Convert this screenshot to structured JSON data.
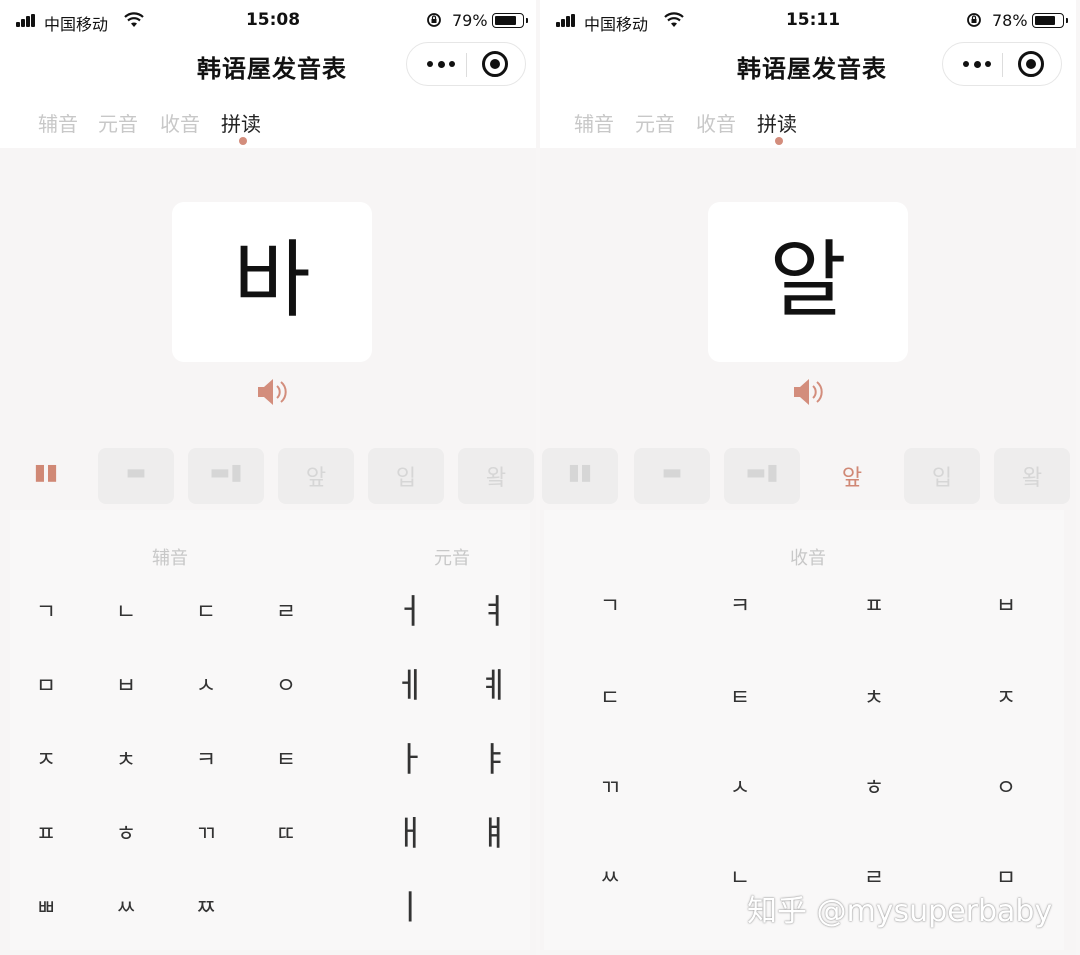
{
  "left": {
    "status": {
      "carrier": "中国移动",
      "time": "15:08",
      "battery": "79%",
      "battery_level": 0.79
    },
    "header": {
      "title": "韩语屋发音表"
    },
    "tabs": [
      {
        "label": "辅音"
      },
      {
        "label": "元音"
      },
      {
        "label": "收音"
      },
      {
        "label": "拼读"
      }
    ],
    "active_tab": 3,
    "syllable": "바",
    "modes": [
      {
        "glyph": "▮▮"
      },
      {
        "glyph": "▬"
      },
      {
        "glyph": "▬▮"
      },
      {
        "glyph": "앞"
      },
      {
        "glyph": "입"
      },
      {
        "glyph": "왘"
      }
    ],
    "active_mode": 0,
    "consonant_header": "辅音",
    "vowel_header": "元音",
    "consonants": [
      "ㄱ",
      "ㄴ",
      "ㄷ",
      "ㄹ",
      "ㅁ",
      "ㅂ",
      "ㅅ",
      "ㅇ",
      "ㅈ",
      "ㅊ",
      "ㅋ",
      "ㅌ",
      "ㅍ",
      "ㅎ",
      "ㄲ",
      "ㄸ",
      "ㅃ",
      "ㅆ",
      "ㅉ"
    ],
    "vowels": [
      "ㅓ",
      "ㅕ",
      "ㅔ",
      "ㅖ",
      "ㅏ",
      "ㅑ",
      "ㅐ",
      "ㅒ",
      "ㅣ"
    ]
  },
  "right": {
    "status": {
      "carrier": "中国移动",
      "time": "15:11",
      "battery": "78%",
      "battery_level": 0.78
    },
    "header": {
      "title": "韩语屋发音表"
    },
    "tabs": [
      {
        "label": "辅音"
      },
      {
        "label": "元音"
      },
      {
        "label": "收音"
      },
      {
        "label": "拼读"
      }
    ],
    "active_tab": 3,
    "syllable": "알",
    "modes": [
      {
        "glyph": "▮▮"
      },
      {
        "glyph": "▬"
      },
      {
        "glyph": "▬▮"
      },
      {
        "glyph": "앞"
      },
      {
        "glyph": "입"
      },
      {
        "glyph": "왘"
      }
    ],
    "active_mode": 3,
    "final_header": "收音",
    "finals": [
      "ㄱ",
      "ㅋ",
      "ㅍ",
      "ㅂ",
      "ㄷ",
      "ㅌ",
      "ㅊ",
      "ㅈ",
      "ㄲ",
      "ㅅ",
      "ㅎ",
      "ㅇ",
      "ㅆ",
      "ㄴ",
      "ㄹ",
      "ㅁ"
    ]
  },
  "watermark": "知乎 @mysuperbaby",
  "colors": {
    "accent": "#d38d7c",
    "inactive": "#c8c8c8",
    "text": "#111111"
  }
}
